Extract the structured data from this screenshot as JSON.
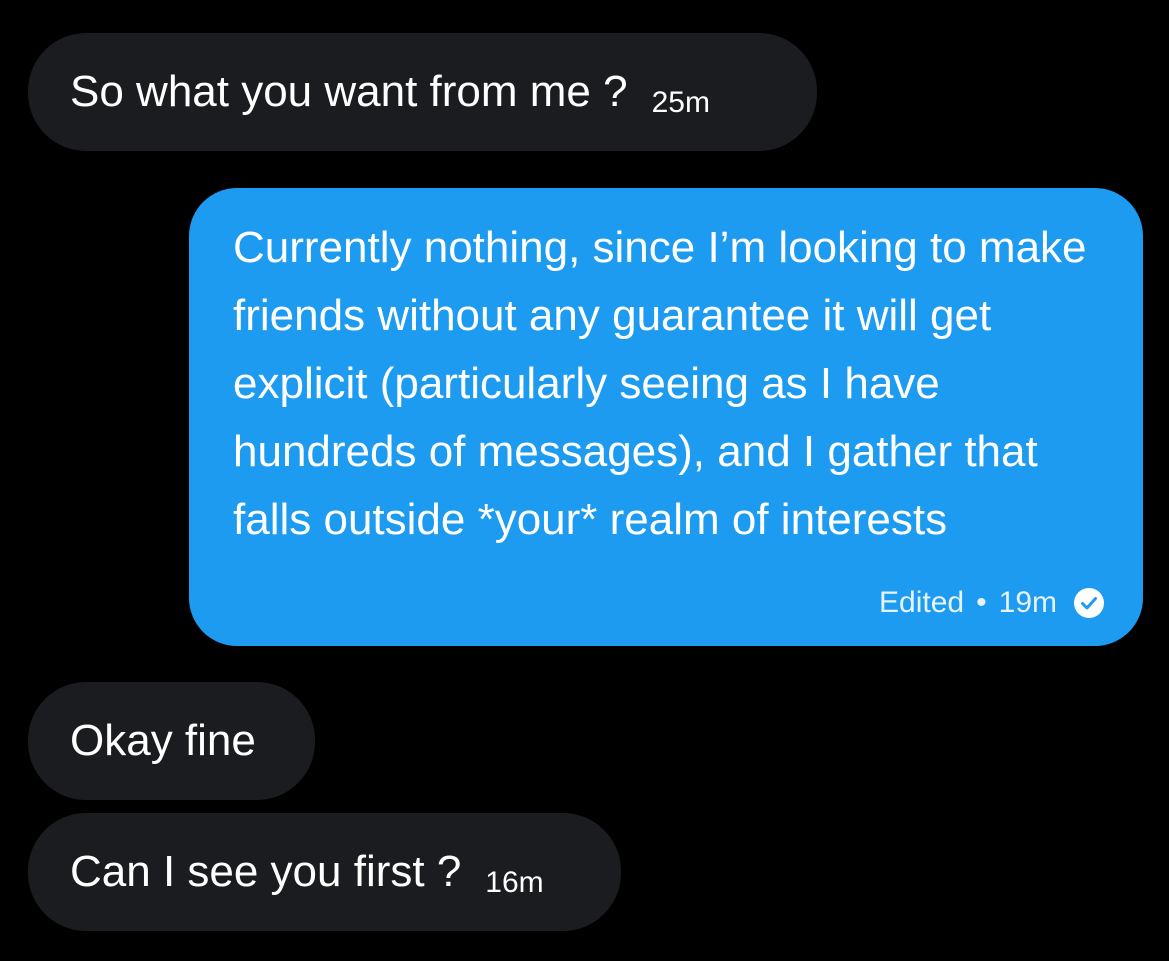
{
  "messages": [
    {
      "direction": "incoming",
      "text": "So what you want from me ?",
      "time": "25m"
    },
    {
      "direction": "outgoing",
      "text": "Currently nothing, since I’m looking to make friends without any guarantee it will get explicit (particularly seeing as I have hundreds of messages), and I gather that falls outside *your* realm of interests",
      "edited_label": "Edited",
      "separator": "•",
      "time": "19m",
      "status_icon": "read-check-icon"
    },
    {
      "direction": "incoming",
      "text": "Okay fine",
      "time": ""
    },
    {
      "direction": "incoming",
      "text": "Can I see you first ?",
      "time": "16m"
    }
  ],
  "colors": {
    "background": "#000000",
    "incoming_bubble": "#1b1c1f",
    "outgoing_bubble": "#1d9bf0",
    "text": "#ffffff"
  }
}
